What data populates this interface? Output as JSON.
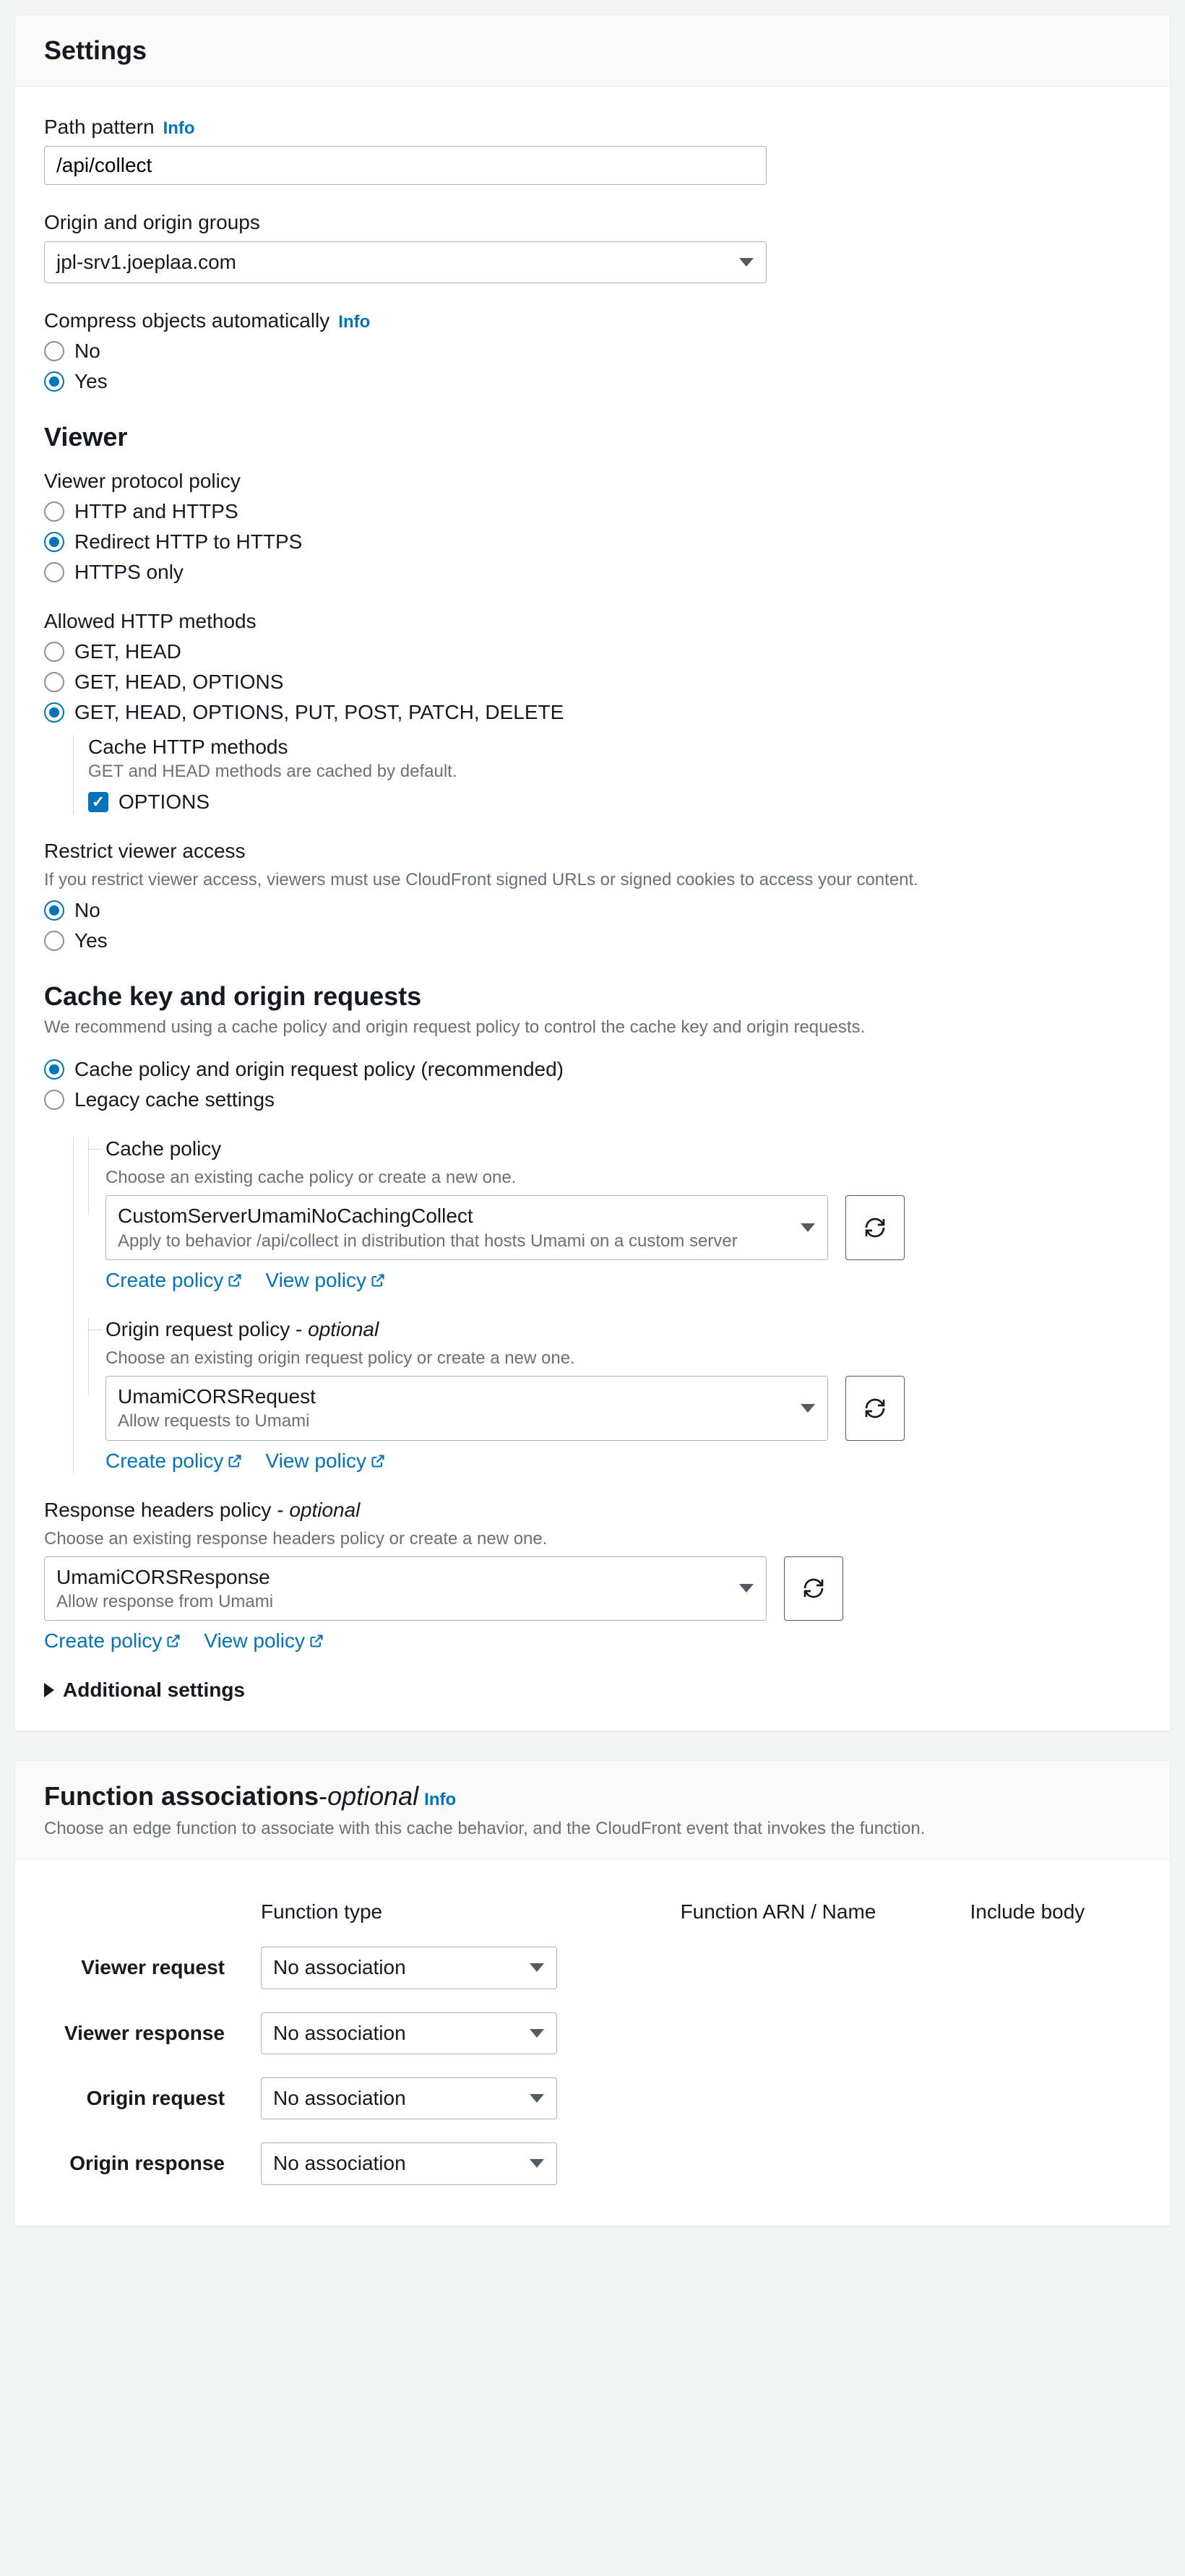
{
  "settings": {
    "title": "Settings",
    "path_pattern": {
      "label": "Path pattern",
      "info": "Info",
      "value": "/api/collect"
    },
    "origin": {
      "label": "Origin and origin groups",
      "value": "jpl-srv1.joeplaa.com"
    },
    "compress": {
      "label": "Compress objects automatically",
      "info": "Info",
      "options": {
        "no": "No",
        "yes": "Yes"
      },
      "selected": "yes"
    },
    "viewer": {
      "title": "Viewer",
      "protocol": {
        "label": "Viewer protocol policy",
        "options": {
          "both": "HTTP and HTTPS",
          "redirect": "Redirect HTTP to HTTPS",
          "https": "HTTPS only"
        },
        "selected": "redirect"
      },
      "methods": {
        "label": "Allowed HTTP methods",
        "options": {
          "gh": "GET, HEAD",
          "gho": "GET, HEAD, OPTIONS",
          "all": "GET, HEAD, OPTIONS, PUT, POST, PATCH, DELETE"
        },
        "selected": "all",
        "cache": {
          "label": "Cache HTTP methods",
          "hint": "GET and HEAD methods are cached by default.",
          "options_label": "OPTIONS",
          "options_checked": true
        }
      },
      "restrict": {
        "label": "Restrict viewer access",
        "hint": "If you restrict viewer access, viewers must use CloudFront signed URLs or signed cookies to access your content.",
        "options": {
          "no": "No",
          "yes": "Yes"
        },
        "selected": "no"
      }
    },
    "cache": {
      "title": "Cache key and origin requests",
      "hint": "We recommend using a cache policy and origin request policy to control the cache key and origin requests.",
      "mode": {
        "options": {
          "policy": "Cache policy and origin request policy (recommended)",
          "legacy": "Legacy cache settings"
        },
        "selected": "policy"
      },
      "cache_policy": {
        "label": "Cache policy",
        "hint": "Choose an existing cache policy or create a new one.",
        "value": "CustomServerUmamiNoCachingCollect",
        "sub": "Apply to behavior /api/collect in distribution that hosts Umami on a custom server"
      },
      "origin_policy": {
        "label": "Origin request policy",
        "optional": "optional",
        "hint_dash": "- ",
        "hint": "Choose an existing origin request policy or create a new one.",
        "value": "UmamiCORSRequest",
        "sub": "Allow requests to Umami"
      },
      "response_policy": {
        "label": "Response headers policy",
        "optional": "optional",
        "hint_dash": "- ",
        "hint": "Choose an existing response headers policy or create a new one.",
        "value": "UmamiCORSResponse",
        "sub": "Allow response from Umami"
      },
      "links": {
        "create": "Create policy",
        "view": "View policy"
      },
      "additional": "Additional settings"
    }
  },
  "functions": {
    "title": "Function associations",
    "title_dash": " - ",
    "optional": "optional",
    "info": "Info",
    "hint": "Choose an edge function to associate with this cache behavior, and the CloudFront event that invokes the function.",
    "headers": {
      "type": "Function type",
      "arn": "Function ARN / Name",
      "body": "Include body"
    },
    "rows": {
      "viewer_request": "Viewer request",
      "viewer_response": "Viewer response",
      "origin_request": "Origin request",
      "origin_response": "Origin response"
    },
    "no_assoc": "No association"
  }
}
